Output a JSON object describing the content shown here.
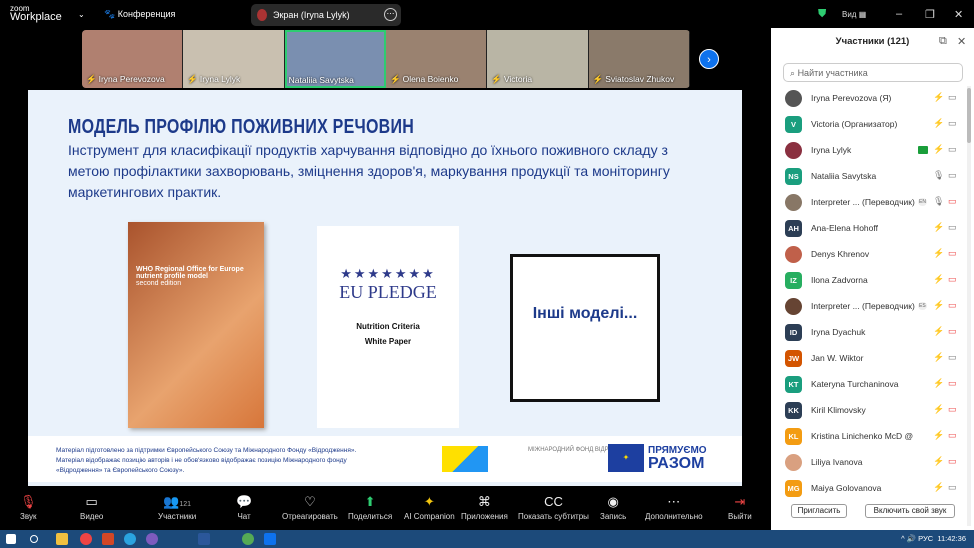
{
  "app": {
    "logo_top": "zoom",
    "logo_bottom": "Workplace",
    "meeting_menu": "Конференция",
    "share_label": "Экран (Iryna Lylyk)",
    "view_label": "Вид"
  },
  "videos": [
    {
      "name": "Iryna Perevozova",
      "bg": "#b08070"
    },
    {
      "name": "Iryna Lylyk",
      "bg": "#c9c0b0"
    },
    {
      "name": "Nataliia Savytska",
      "bg": "#7a8fb0",
      "active": true
    },
    {
      "name": "Olena Boienko",
      "bg": "#9a8270"
    },
    {
      "name": "Victoria",
      "bg": "#b9b5a5"
    },
    {
      "name": "Sviatoslav Zhukov",
      "bg": "#8a7a6a"
    }
  ],
  "slide": {
    "title": "МОДЕЛЬ ПРОФІЛЮ ПОЖИВНИХ РЕЧОВИН",
    "subtitle": "Інструмент для класифікації продуктів харчування відповідно до їхнього поживного складу з метою профілактики захворювань, зміцнення здоров'я, маркування продукції та моніторингу маркетингових практик.",
    "who_title": "WHO Regional Office for Europe nutrient profile model",
    "who_edition": "second edition",
    "eu_logo": "EU PLEDGE",
    "eu_doc": "Nutrition Criteria",
    "eu_doc2": "White Paper",
    "other_models": "Інші моделі...",
    "footer": "Матеріал підготовлено за підтримки Європейського Союзу та Міжнародного Фонду «Відродження». Матеріал відображає позицію авторів і не обов'язково відображає позицію Міжнародного фонду «Відродження» та Європейського Союзу».",
    "irf_logo": "МІЖНАРОДНИЙ ФОНД ВІДРОДЖЕННЯ",
    "eu_together_1": "ПРЯМУЄМО",
    "eu_together_2": "РАЗОМ"
  },
  "panel": {
    "title": "Участники (121)",
    "search_placeholder": "Найти участника",
    "invite": "Пригласить",
    "unmute": "Включить свой звук",
    "participants": [
      {
        "name": "Iryna Perevozova (Я)",
        "initials": "",
        "color": "#555",
        "cam": "on"
      },
      {
        "name": "Victoria (Организатор)",
        "initials": "V",
        "color": "#1a9e7e",
        "cam": "on"
      },
      {
        "name": "Iryna Lylyk",
        "initials": "",
        "color": "#8a3040",
        "cam": "on",
        "share": true
      },
      {
        "name": "Nataliia Savytska",
        "initials": "NS",
        "color": "#1a9e7e",
        "cam": "on",
        "mic": "on"
      },
      {
        "name": "Interpreter ...  (Переводчик)",
        "initials": "",
        "color": "#887766",
        "cam": "off",
        "mic": "on",
        "lang": "EN"
      },
      {
        "name": "Ana-Elena Hohoff",
        "initials": "AH",
        "color": "#2c3e55",
        "cam": "on"
      },
      {
        "name": "Denys Khrenov",
        "initials": "",
        "color": "#c0604a",
        "cam": "off"
      },
      {
        "name": "Ilona Zadvorna",
        "initials": "IZ",
        "color": "#27ae60",
        "cam": "off"
      },
      {
        "name": "Interpreter ...  (Переводчик)",
        "initials": "",
        "color": "#664433",
        "cam": "off",
        "lang": "ES"
      },
      {
        "name": "Iryna Dyachuk",
        "initials": "ID",
        "color": "#2c3e55",
        "cam": "off"
      },
      {
        "name": "Jan W. Wiktor",
        "initials": "JW",
        "color": "#d35400",
        "cam": "on"
      },
      {
        "name": "Kateryna Turchaninova",
        "initials": "KT",
        "color": "#1a9e7e",
        "cam": "off"
      },
      {
        "name": "Kiril Klimovsky",
        "initials": "KK",
        "color": "#2c3e55",
        "cam": "off"
      },
      {
        "name": "Kristina Linichenko McD @",
        "initials": "KL",
        "color": "#f39c12",
        "cam": "off"
      },
      {
        "name": "Liliya Ivanova",
        "initials": "",
        "color": "#d9a080",
        "cam": "off"
      },
      {
        "name": "Maiya Golovanova",
        "initials": "MG",
        "color": "#f39c12",
        "cam": "on"
      }
    ]
  },
  "toolbar": [
    {
      "label": "Звук",
      "icon": "🎙"
    },
    {
      "label": "Видео",
      "icon": "▭"
    },
    {
      "label": "Участники",
      "icon": "👥",
      "count": "121"
    },
    {
      "label": "Чат",
      "icon": "💬"
    },
    {
      "label": "Отреагировать",
      "icon": "♡"
    },
    {
      "label": "Поделиться",
      "icon": "⬆"
    },
    {
      "label": "AI Companion",
      "icon": "✦"
    },
    {
      "label": "Приложения",
      "icon": "⌘"
    },
    {
      "label": "Показать субтитры",
      "icon": "CC"
    },
    {
      "label": "Запись",
      "icon": "◉"
    },
    {
      "label": "Дополнительно",
      "icon": "⋯"
    },
    {
      "label": "Выйти",
      "icon": "⇥"
    }
  ],
  "taskbar": {
    "lang": "РУС",
    "time": "11:42:36"
  }
}
